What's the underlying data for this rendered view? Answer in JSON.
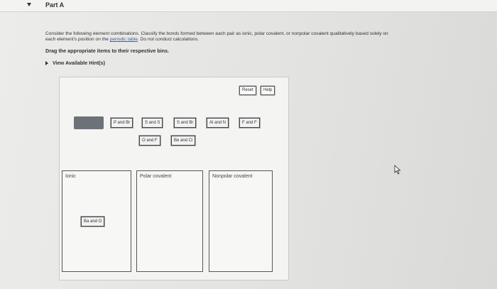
{
  "part": {
    "title": "Part A"
  },
  "instructions": {
    "line1_a": "Consider the following element combinations. Classify the bonds formed between each pair as ionic, polar covalent, or nonpolar covalent qualitatively based solely on",
    "line2_a": "each element's position on the ",
    "link": "periodic table",
    "line2_b": ". Do not conduct calculations.",
    "drag_note": "Drag the appropriate items to their respective bins.",
    "hints": "View Available Hint(s)"
  },
  "toolbar": {
    "reset": "Reset",
    "help": "Help"
  },
  "tokens": [
    "P and Br",
    "S and S",
    "S and Br",
    "Al and N",
    "F and F",
    "O and F",
    "Be and Cl"
  ],
  "bins": [
    {
      "label": "Ionic",
      "items": [
        "Ba and O"
      ]
    },
    {
      "label": "Polar covalent",
      "items": []
    },
    {
      "label": "Nonpolar covalent",
      "items": []
    }
  ]
}
